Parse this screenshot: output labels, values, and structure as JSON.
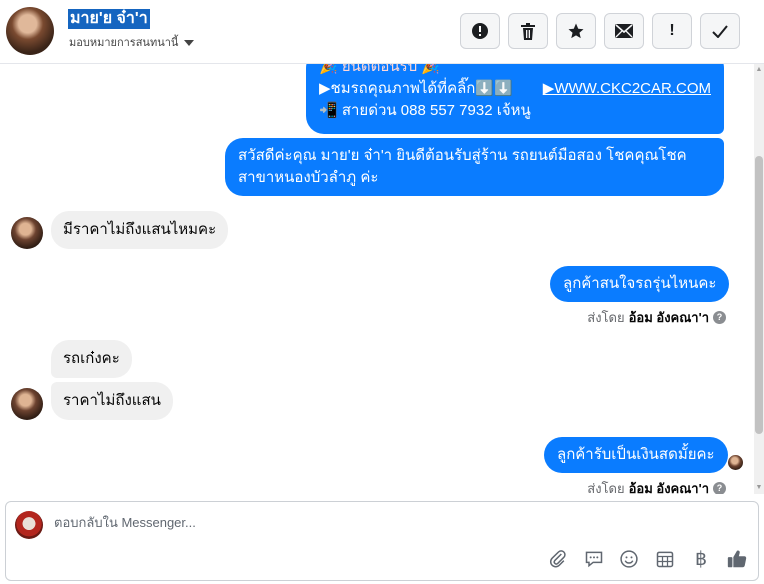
{
  "header": {
    "contact_name": "มาย'ย จ๋า'า",
    "assign_label": "มอบหมายการสนทนานี้",
    "actions": [
      {
        "name": "mark-spam-button",
        "icon": "exclamation-circle-icon",
        "glyph": "!"
      },
      {
        "name": "delete-button",
        "icon": "trash-icon",
        "glyph": "🗑"
      },
      {
        "name": "star-button",
        "icon": "star-icon",
        "glyph": "★"
      },
      {
        "name": "mark-unread-button",
        "icon": "envelope-icon",
        "glyph": "✉"
      },
      {
        "name": "follow-up-button",
        "icon": "exclamation-icon",
        "glyph": "!"
      },
      {
        "name": "mark-done-button",
        "icon": "checkmark-icon",
        "glyph": "✓"
      }
    ]
  },
  "messages": {
    "welcome_line1": "▶ชมรถคุณภาพได้ที่คลิ๊ก⬇️⬇️",
    "welcome_link": "▶WWW.CKC2CAR.COM",
    "welcome_line2": "📲 สายด่วน 088 557 7932 เจ้หนู",
    "greeting": "สวัสดีค่ะคุณ มาย'ย จ๋า'า ยินดีต้อนรับสู่ร้าน รถยนต์มือสอง โชคคุณโชค สาขาหนองบัวลำภู ค่ะ",
    "in_1": "มีราคาไม่ถึงแสนไหมคะ",
    "out_1": "ลูกค้าสนใจรถรุ่นไหนคะ",
    "sent_by_prefix": "ส่งโดย",
    "sent_by_name": "อ้อม อังคณา'า",
    "in_2": "รถเก๋งคะ",
    "in_3": "ราคาไม่ถึงแสน",
    "out_2": "ลูกค้ารับเป็นเงินสดมั้ยคะ",
    "sent_by_prefix_2": "ส่งโดย",
    "sent_by_name_2": "อ้อม อังคณา'า"
  },
  "composer": {
    "placeholder": "ตอบกลับใน Messenger...",
    "tools": [
      {
        "name": "attach-icon",
        "glyph": "📎"
      },
      {
        "name": "saved-replies-icon",
        "glyph": "💬"
      },
      {
        "name": "emoji-icon",
        "glyph": "☺"
      },
      {
        "name": "appointment-icon",
        "glyph": "▦"
      },
      {
        "name": "payment-icon",
        "glyph": "฿"
      },
      {
        "name": "like-icon",
        "glyph": "👍"
      }
    ]
  }
}
